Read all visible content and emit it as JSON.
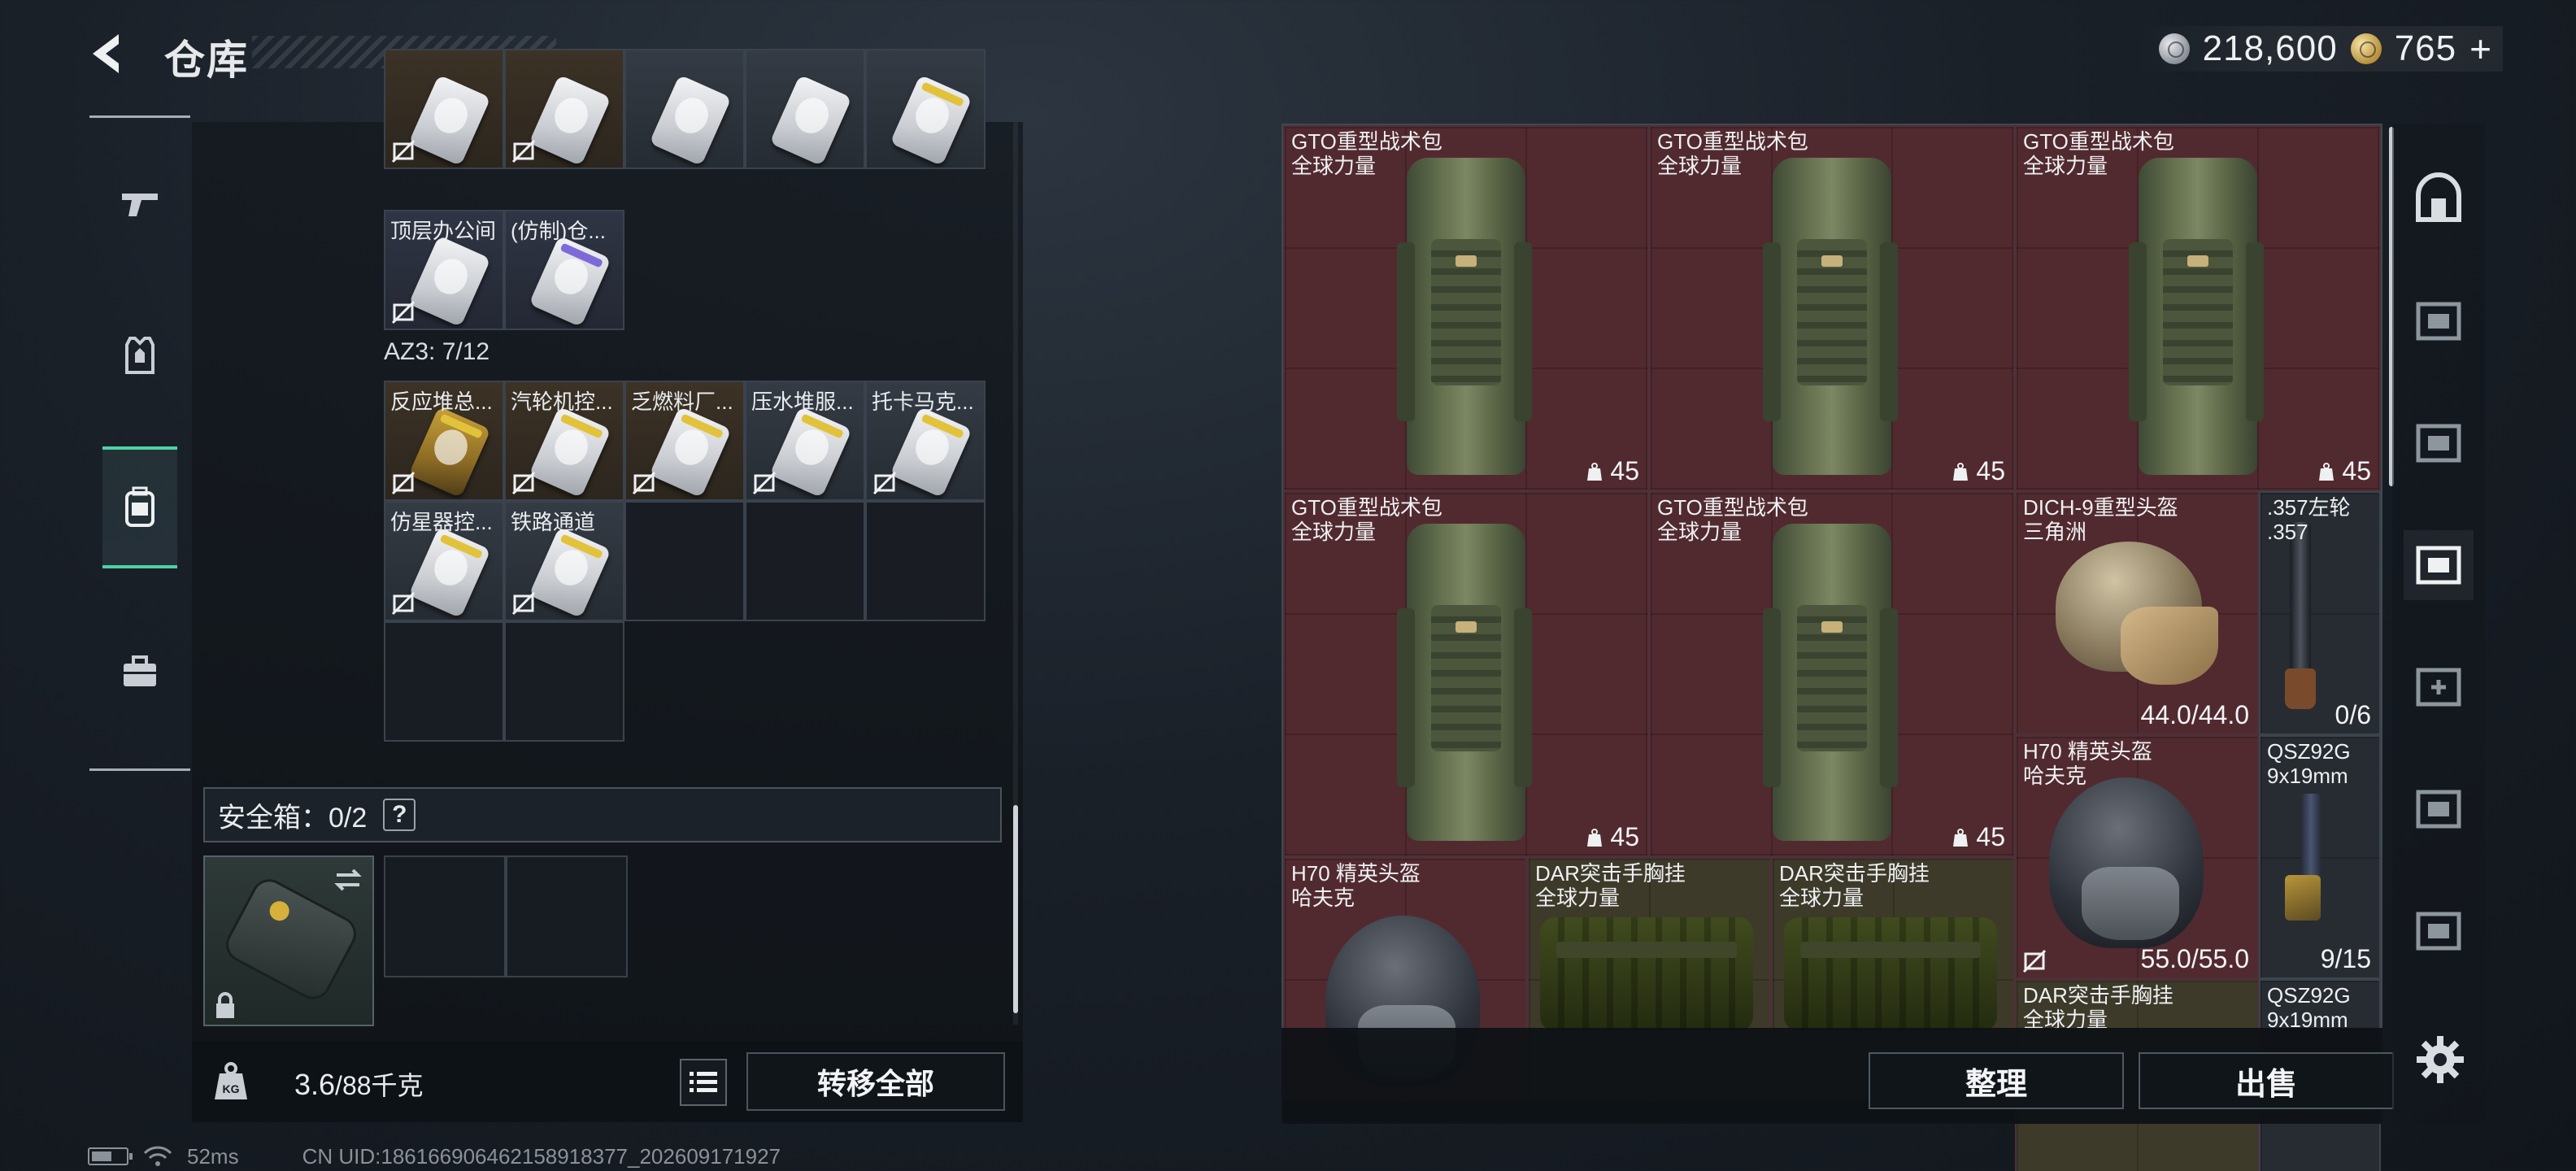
{
  "header": {
    "title": "仓库",
    "silver_amount": "218,600",
    "gold_amount": "765",
    "plus_label": "+"
  },
  "left_rail": {
    "tabs": [
      {
        "icon": "pistol-icon",
        "active": false
      },
      {
        "icon": "armor-vest-icon",
        "active": false
      },
      {
        "icon": "backpack-icon",
        "active": true
      },
      {
        "icon": "toolbox-icon",
        "active": false
      }
    ]
  },
  "keycards": {
    "top_row": [
      "",
      "",
      "",
      "",
      ""
    ],
    "second_row": [
      "顶层办公间",
      "(仿制)仓..."
    ],
    "az3_label": "AZ3: 7/12",
    "az3_row1": [
      "反应堆总...",
      "汽轮机控...",
      "乏燃料厂...",
      "压水堆服...",
      "托卡马克..."
    ],
    "az3_row2": [
      "仿星器控...",
      "铁路通道"
    ]
  },
  "safebox": {
    "label": "安全箱：0/2",
    "help": "?"
  },
  "weight": {
    "current": "3.6",
    "max": "/88千克"
  },
  "transfer_all": "转移全部",
  "stash_items": [
    {
      "name": "GTO重型战术包",
      "sub": "全球力量",
      "value": "45"
    },
    {
      "name": "GTO重型战术包",
      "sub": "全球力量",
      "value": "45"
    },
    {
      "name": "GTO重型战术包",
      "sub": "全球力量",
      "value": "45"
    },
    {
      "name": "GTO重型战术包",
      "sub": "全球力量",
      "value": "45"
    },
    {
      "name": "GTO重型战术包",
      "sub": "全球力量",
      "value": "45"
    },
    {
      "name": "DICH-9重型头盔",
      "sub": "三角洲",
      "value": "44.0/44.0"
    },
    {
      "name": ".357左轮",
      "sub": ".357",
      "value": "0/6"
    },
    {
      "name": "H70 精英头盔",
      "sub": "哈夫克",
      "value": "55.0/55.0"
    },
    {
      "name": "QSZ92G",
      "sub": "9x19mm",
      "value": "9/15"
    },
    {
      "name": "H70 精英头盔",
      "sub": "哈夫克",
      "value": ""
    },
    {
      "name": "DAR突击手胸挂",
      "sub": "全球力量",
      "value": ""
    },
    {
      "name": "DAR突击手胸挂",
      "sub": "全球力量",
      "value": ""
    },
    {
      "name": "DAR突击手胸挂",
      "sub": "全球力量",
      "value": ""
    },
    {
      "name": "QSZ92G",
      "sub": "9x19mm",
      "value": ""
    }
  ],
  "buttons": {
    "sort": "整理",
    "sell": "出售"
  },
  "status": {
    "ping": "52ms",
    "uid": "CN UID:1861669064621589183​77_202609171927"
  },
  "colors": {
    "accent": "#4fd1a5",
    "item_red": "#512a2f"
  }
}
